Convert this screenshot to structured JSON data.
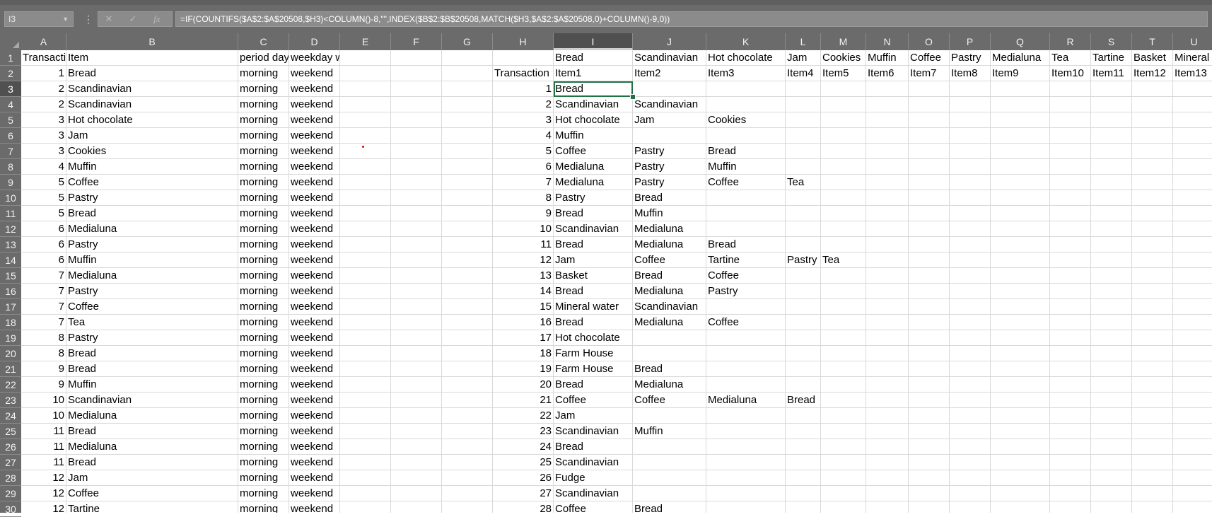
{
  "formula_bar": {
    "name_box": "I3",
    "fx_label": "fx",
    "formula": "=IF(COUNTIFS($A$2:$A$20508,$H3)<COLUMN()-8,\"\",INDEX($B$2:$B$20508,MATCH($H3,$A$2:$A$20508,0)+COLUMN()-9,0))"
  },
  "columns": [
    "A",
    "B",
    "C",
    "D",
    "E",
    "F",
    "G",
    "H",
    "I",
    "J",
    "K",
    "L",
    "M",
    "N",
    "O",
    "P",
    "Q",
    "R",
    "S",
    "T",
    "U"
  ],
  "selected_column": "I",
  "rows_visible": [
    "1",
    "2",
    "3",
    "4",
    "5",
    "6",
    "7",
    "8",
    "9",
    "10",
    "11",
    "12",
    "13",
    "14",
    "15",
    "16",
    "17",
    "18",
    "19",
    "20",
    "21",
    "22",
    "23",
    "24",
    "25",
    "26",
    "27",
    "28",
    "29",
    "30"
  ],
  "selected_row": "3",
  "sheet": {
    "header_left": [
      "Transactio",
      "Item",
      "period day",
      "weekday weekend"
    ],
    "row1_right": [
      "Bread",
      "Scandinavian",
      "Hot chocolate",
      "Jam",
      "Cookies",
      "Muffin",
      "Coffee",
      "Pastry",
      "Medialuna",
      "Tea",
      "Tartine",
      "Basket",
      "Mineral"
    ],
    "row2_h": "Transaction",
    "row2_right": [
      "Item1",
      "Item2",
      "Item3",
      "Item4",
      "Item5",
      "Item6",
      "Item7",
      "Item8",
      "Item9",
      "Item10",
      "Item11",
      "Item12",
      "Item13"
    ],
    "left_rows": [
      [
        "1",
        "Bread",
        "morning",
        "weekend"
      ],
      [
        "2",
        "Scandinavian",
        "morning",
        "weekend"
      ],
      [
        "2",
        "Scandinavian",
        "morning",
        "weekend"
      ],
      [
        "3",
        "Hot chocolate",
        "morning",
        "weekend"
      ],
      [
        "3",
        "Jam",
        "morning",
        "weekend"
      ],
      [
        "3",
        "Cookies",
        "morning",
        "weekend"
      ],
      [
        "4",
        "Muffin",
        "morning",
        "weekend"
      ],
      [
        "5",
        "Coffee",
        "morning",
        "weekend"
      ],
      [
        "5",
        "Pastry",
        "morning",
        "weekend"
      ],
      [
        "5",
        "Bread",
        "morning",
        "weekend"
      ],
      [
        "6",
        "Medialuna",
        "morning",
        "weekend"
      ],
      [
        "6",
        "Pastry",
        "morning",
        "weekend"
      ],
      [
        "6",
        "Muffin",
        "morning",
        "weekend"
      ],
      [
        "7",
        "Medialuna",
        "morning",
        "weekend"
      ],
      [
        "7",
        "Pastry",
        "morning",
        "weekend"
      ],
      [
        "7",
        "Coffee",
        "morning",
        "weekend"
      ],
      [
        "7",
        "Tea",
        "morning",
        "weekend"
      ],
      [
        "8",
        "Pastry",
        "morning",
        "weekend"
      ],
      [
        "8",
        "Bread",
        "morning",
        "weekend"
      ],
      [
        "9",
        "Bread",
        "morning",
        "weekend"
      ],
      [
        "9",
        "Muffin",
        "morning",
        "weekend"
      ],
      [
        "10",
        "Scandinavian",
        "morning",
        "weekend"
      ],
      [
        "10",
        "Medialuna",
        "morning",
        "weekend"
      ],
      [
        "11",
        "Bread",
        "morning",
        "weekend"
      ],
      [
        "11",
        "Medialuna",
        "morning",
        "weekend"
      ],
      [
        "11",
        "Bread",
        "morning",
        "weekend"
      ],
      [
        "12",
        "Jam",
        "morning",
        "weekend"
      ],
      [
        "12",
        "Coffee",
        "morning",
        "weekend"
      ],
      [
        "12",
        "Tartine",
        "morning",
        "weekend"
      ]
    ],
    "right_rows": [
      [
        "1",
        "Bread",
        "",
        "",
        "",
        ""
      ],
      [
        "2",
        "Scandinavian",
        "Scandinavian",
        "",
        "",
        ""
      ],
      [
        "3",
        "Hot chocolate",
        "Jam",
        "Cookies",
        "",
        ""
      ],
      [
        "4",
        "Muffin",
        "",
        "",
        "",
        ""
      ],
      [
        "5",
        "Coffee",
        "Pastry",
        "Bread",
        "",
        ""
      ],
      [
        "6",
        "Medialuna",
        "Pastry",
        "Muffin",
        "",
        ""
      ],
      [
        "7",
        "Medialuna",
        "Pastry",
        "Coffee",
        "Tea",
        ""
      ],
      [
        "8",
        "Pastry",
        "Bread",
        "",
        "",
        ""
      ],
      [
        "9",
        "Bread",
        "Muffin",
        "",
        "",
        ""
      ],
      [
        "10",
        "Scandinavian",
        "Medialuna",
        "",
        "",
        ""
      ],
      [
        "11",
        "Bread",
        "Medialuna",
        "Bread",
        "",
        ""
      ],
      [
        "12",
        "Jam",
        "Coffee",
        "Tartine",
        "Pastry",
        "Tea"
      ],
      [
        "13",
        "Basket",
        "Bread",
        "Coffee",
        "",
        ""
      ],
      [
        "14",
        "Bread",
        "Medialuna",
        "Pastry",
        "",
        ""
      ],
      [
        "15",
        "Mineral water",
        "Scandinavian",
        "",
        "",
        ""
      ],
      [
        "16",
        "Bread",
        "Medialuna",
        "Coffee",
        "",
        ""
      ],
      [
        "17",
        "Hot chocolate",
        "",
        "",
        "",
        ""
      ],
      [
        "18",
        "Farm House",
        "",
        "",
        "",
        ""
      ],
      [
        "19",
        "Farm House",
        "Bread",
        "",
        "",
        ""
      ],
      [
        "20",
        "Bread",
        "Medialuna",
        "",
        "",
        ""
      ],
      [
        "21",
        "Coffee",
        "Coffee",
        "Medialuna",
        "Bread",
        ""
      ],
      [
        "22",
        "Jam",
        "",
        "",
        "",
        ""
      ],
      [
        "23",
        "Scandinavian",
        "Muffin",
        "",
        "",
        ""
      ],
      [
        "24",
        "Bread",
        "",
        "",
        "",
        ""
      ],
      [
        "25",
        "Scandinavian",
        "",
        "",
        "",
        ""
      ],
      [
        "26",
        "Fudge",
        "",
        "",
        "",
        ""
      ],
      [
        "27",
        "Scandinavian",
        "",
        "",
        "",
        ""
      ],
      [
        "28",
        "Coffee",
        "Bread",
        "",
        "",
        ""
      ]
    ]
  }
}
